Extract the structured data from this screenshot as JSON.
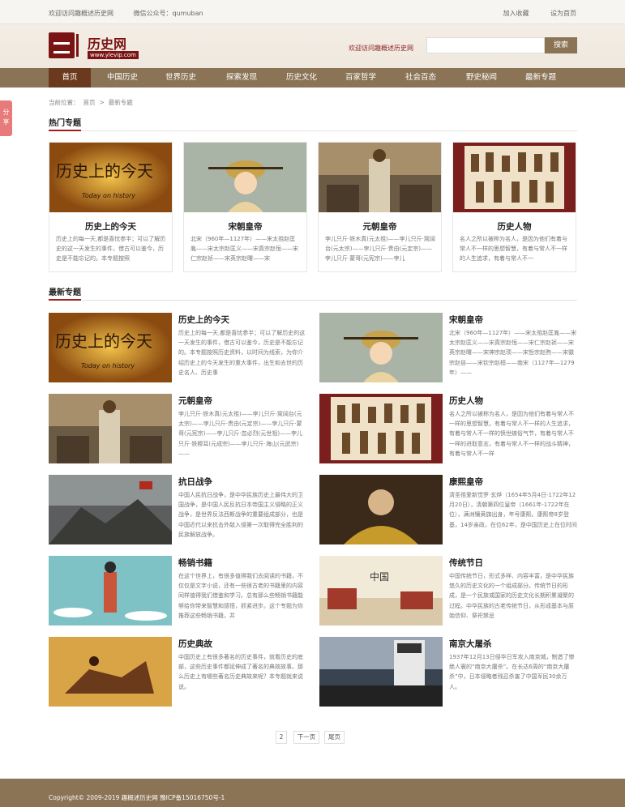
{
  "topbar": {
    "welcome": "欢迎访问趣概述历史网",
    "wechat": "微信公众号：qumuban",
    "favorite": "加入收藏",
    "homepage": "设为首页"
  },
  "header": {
    "logo_name": "历史网",
    "logo_url": "www.ylevip.com",
    "welcome": "欢迎访问趣概述历史网",
    "search_placeholder": "",
    "search_button": "搜索"
  },
  "nav": {
    "items": [
      "首页",
      "中国历史",
      "世界历史",
      "探索发现",
      "历史文化",
      "百家哲学",
      "社会百态",
      "野史秘闻",
      "最新专题"
    ]
  },
  "side_share": "分享",
  "breadcrumb": {
    "prefix": "当前位置：",
    "home": "首页",
    "sep": ">",
    "current": "最新专题"
  },
  "hot": {
    "title": "热门专题",
    "cards": [
      {
        "title": "历史上的今天",
        "desc": "历史上的每一天,都是喜忧参半；可以了解历史的这一天发生的事件，借古可以鉴今，历史是不能忘记的。本专题按照"
      },
      {
        "title": "宋朝皇帝",
        "desc": "北宋（960年—1127年）——宋太祖赵匡胤——宋太宗赵匡义——宋真宗赵恒——宋仁宗赵祯——宋英宗赵曙——宋"
      },
      {
        "title": "元朝皇帝",
        "desc": "孛儿只斤·铁木真(元太祖)——孛儿只斤·窝阔台(元太宗)——孛儿只斤·贵由(元定宗)——孛儿只斤·蒙哥(元宪宗)——孛儿"
      },
      {
        "title": "历史人物",
        "desc": "名人之所以被称为名人，是因为他们有着与常人不一样的思想智慧，有着与常人不一样的人生追求，有着与常人不一"
      }
    ]
  },
  "latest": {
    "title": "最新专题",
    "items": [
      {
        "title": "历史上的今天",
        "desc": "历史上的每一天,都是喜忧参半；可以了解历史的这一天发生的事件，借古可以鉴今，历史是不能忘记的。本专题按照历史资料，以时间为线索，为你介绍历史上的今天发生的重大事件，出生和去世的历史名人、历史事"
      },
      {
        "title": "宋朝皇帝",
        "desc": "北宋（960年—1127年）——宋太祖赵匡胤——宋太宗赵匡义——宋真宗赵恒——宋仁宗赵祯——宋英宗赵曙——宋神宗赵顼——宋哲宗赵煦——宋徽宗赵佶——宋钦宗赵桓——南宋（1127年—1279年）——"
      },
      {
        "title": "元朝皇帝",
        "desc": "孛儿只斤·铁木真(元太祖)——孛儿只斤·窝阔台(元太宗)——孛儿只斤·贵由(元定宗)——孛儿只斤·蒙哥(元宪宗)——孛儿只斤·忽必烈(元世祖)——孛儿只斤·铁穆耳(元成宗)——孛儿只斤·海山(元武宗)——"
      },
      {
        "title": "历史人物",
        "desc": "名人之所以被称为名人，是因为他们有着与常人不一样的思想智慧，有着与常人不一样的人生追求，有着与常人不一样的愤世嫉俗气节，有着与常人不一样的进取意志，有着与常人不一样的战斗精神，有着与常人不一样"
      },
      {
        "title": "抗日战争",
        "desc": "中国人民抗日战争，是中华民族历史上最伟大的卫国战争，是中国人民反抗日本帝国主义侵略的正义战争，是世界反法西斯战争的重要组成部分，也是中国近代以来抗击外敌入侵第一次取得完全胜利的民族解放战争。"
      },
      {
        "title": "康熙皇帝",
        "desc": "清圣祖爱新觉罗·玄烨（1654年5月4日-1722年12月20日），清朝第四位皇帝（1661年-1722年在位），满洲镶黄旗出身，年号康熙。康熙帝8岁登基，14岁亲政，在位62年，是中国历史上在位时间"
      },
      {
        "title": "畅销书籍",
        "desc": "在这个世界上，有很多值得我们去阅读的书籍，不仅仅是文字小说，还有一些很古老的书籍里的内容同样值得我们借鉴和学习。总有那么些畅销书籍能够给你带来智慧和感悟，抓紧进步。这个专题为你推荐这些畅销书籍，并"
      },
      {
        "title": "传统节日",
        "desc": "中国传统节日，形式多样、内容丰富，是中华民族悠久的历史文化的一个组成部分。传统节日的形成，是一个民族或国家的历史文化长期积累凝聚的过程。中华民族的古老传统节日，从形成基本与原始信仰、祭祀禁忌"
      },
      {
        "title": "历史典故",
        "desc": "中国历史上有很多著名的历史事件，就看历史的底部，这些历史事件都延伸成了著名的典故故事。那么历史上有哪些著名历史典故来呢？本专题就来说说。"
      },
      {
        "title": "南京大屠杀",
        "desc": "1937年12月13日侵华日军攻入南京城，制造了惨绝人寰的“南京大屠杀”。在长达6周的“南京大屠杀”中，日本侵略者残忍杀害了中国军民30余万人。"
      }
    ]
  },
  "pager": {
    "page": "2",
    "next": "下一页",
    "last": "尾页"
  },
  "footer": "Copyright© 2009-2019 趣概述历史网   豫ICP备15016750号-1",
  "colors": {
    "nav": "#8b7355",
    "active": "#6b3a1e",
    "accent": "#a41d1d"
  }
}
